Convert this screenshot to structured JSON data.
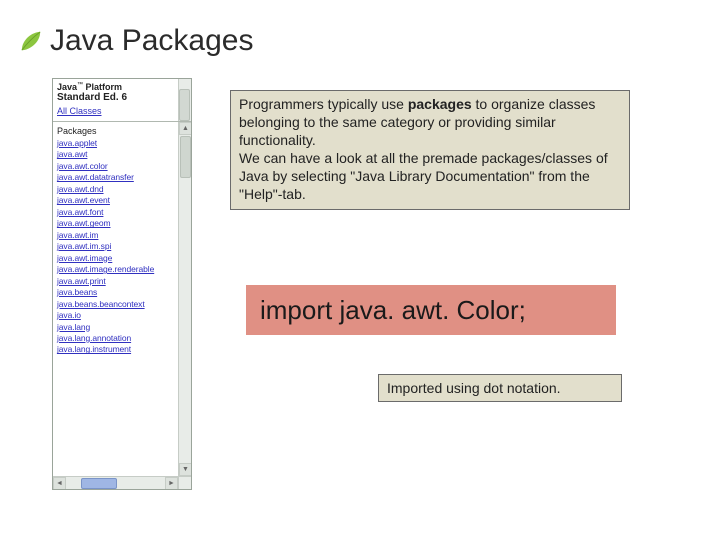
{
  "title": "Java Packages",
  "api_pane": {
    "logo_java": "Java",
    "logo_tm": "™",
    "logo_platform": "Platform",
    "logo_edition": "Standard Ed. 6",
    "all_classes": "All Classes",
    "packages_heading": "Packages",
    "packages": [
      "java.applet",
      "java.awt",
      "java.awt.color",
      "java.awt.datatransfer",
      "java.awt.dnd",
      "java.awt.event",
      "java.awt.font",
      "java.awt.geom",
      "java.awt.im",
      "java.awt.im.spi",
      "java.awt.image",
      "java.awt.image.renderable",
      "java.awt.print",
      "java.beans",
      "java.beans.beancontext",
      "java.io",
      "java.lang",
      "java.lang.annotation",
      "java.lang.instrument"
    ]
  },
  "description": {
    "line1a": "Programmers typically use ",
    "line1b": "packages",
    "line1c": " to organize classes belonging to the same category or providing similar functionality.",
    "line2": "We can have a look at all the premade packages/classes of Java by selecting \"Java Library Documentation\" from the \"Help\"-tab."
  },
  "import_statement": "import java. awt. Color;",
  "note": "Imported using dot notation."
}
